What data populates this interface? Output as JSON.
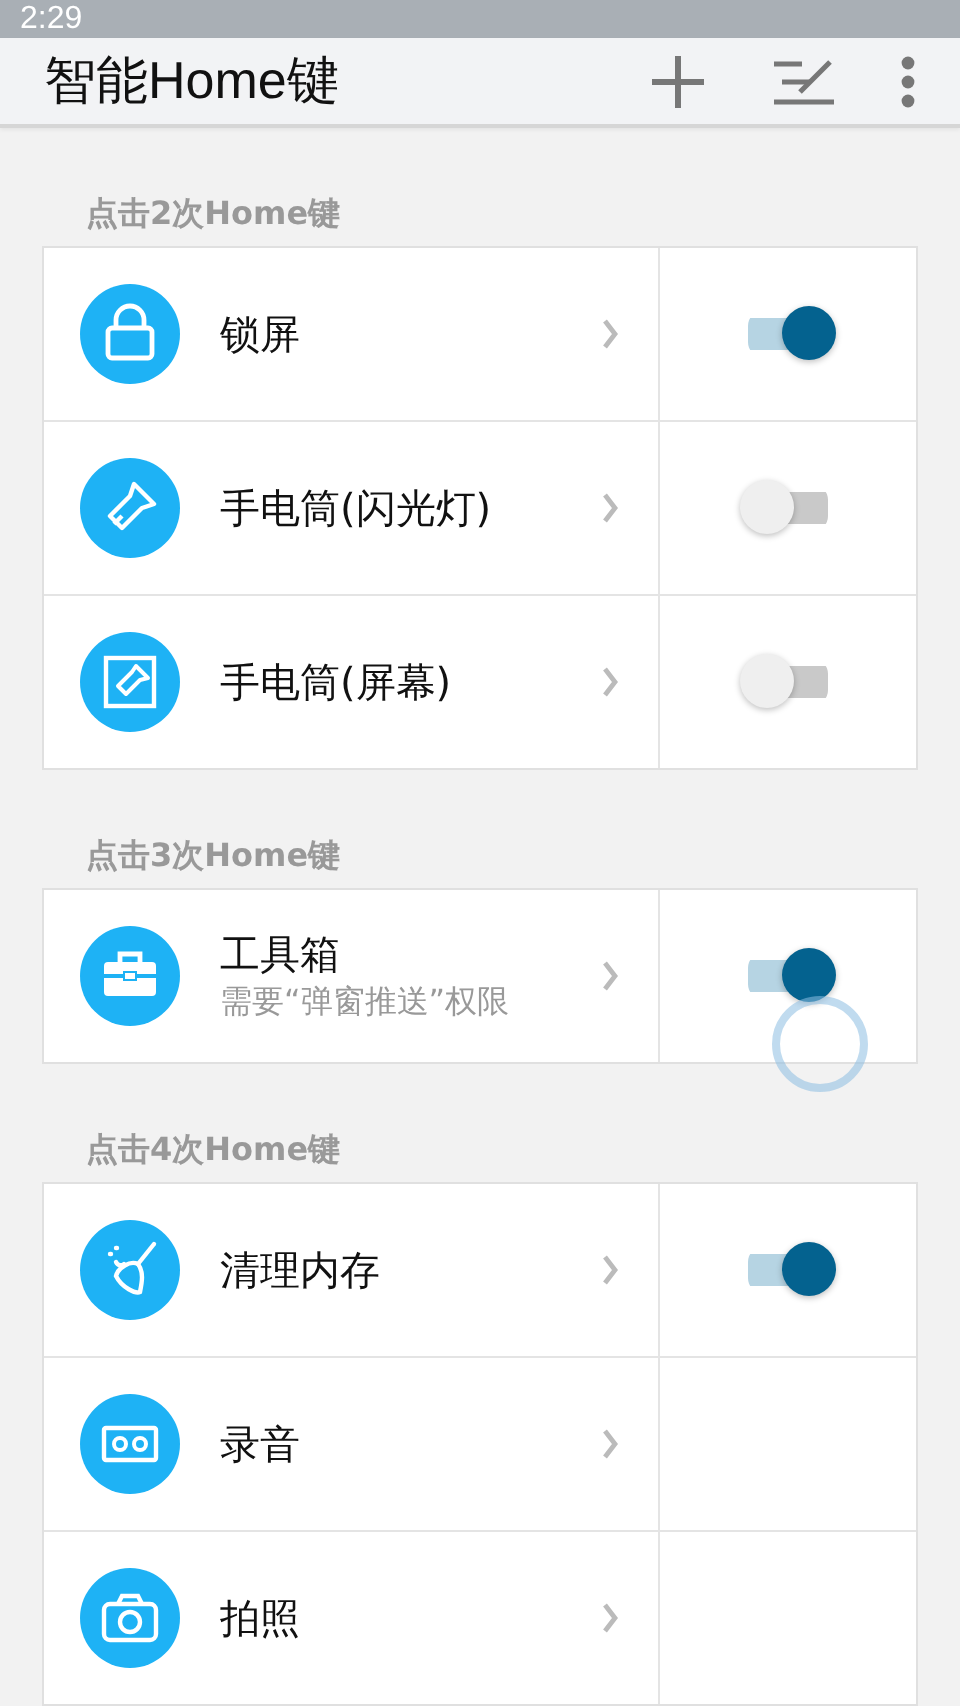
{
  "status_bar": {
    "time": "2:29"
  },
  "app_bar": {
    "title": "智能Home键"
  },
  "sections": [
    {
      "header": "点击2次Home键",
      "items": [
        {
          "kind": "lock",
          "label": "锁屏",
          "on": true
        },
        {
          "kind": "flashlight",
          "label": "手电筒(闪光灯)",
          "on": false
        },
        {
          "kind": "screen-light",
          "label": "手电筒(屏幕)",
          "on": false
        }
      ]
    },
    {
      "header": "点击3次Home键",
      "items": [
        {
          "kind": "toolbox",
          "label": "工具箱",
          "subtitle": "需要“弹窗推送”权限",
          "on": true,
          "pressed": true
        }
      ]
    },
    {
      "header": "点击4次Home键",
      "items": [
        {
          "kind": "broom",
          "label": "清理内存",
          "on": true
        },
        {
          "kind": "tape",
          "label": "录音"
        },
        {
          "kind": "camera",
          "label": "拍照"
        }
      ]
    }
  ]
}
